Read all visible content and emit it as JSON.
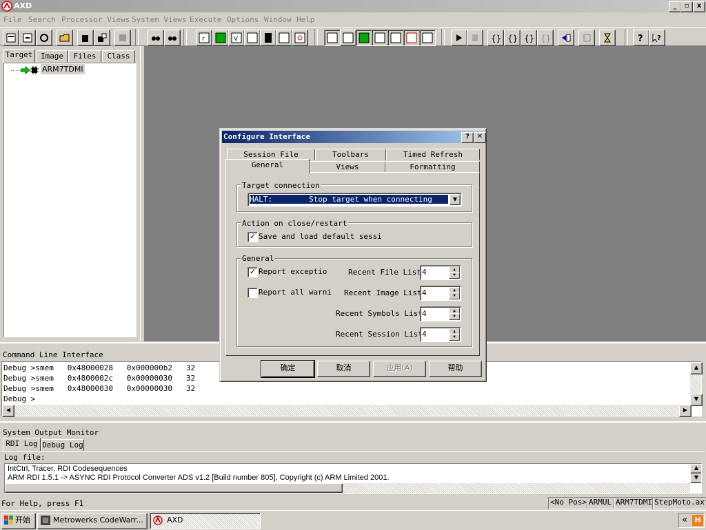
{
  "window": {
    "title": "AXD"
  },
  "menu": [
    "File",
    "Search",
    "Processor Views",
    "System Views",
    "Execute",
    "Options",
    "Window",
    "Help"
  ],
  "left_pane": {
    "tabs": [
      "Target",
      "Image",
      "Files",
      "Class"
    ],
    "tree_item": "ARM7TDMI"
  },
  "dialog": {
    "title": "Configure Interface",
    "help_btn": "?",
    "close_btn": "✕",
    "tabs_back": [
      "Session File",
      "Toolbars",
      "Timed Refresh"
    ],
    "tabs_front": [
      "General",
      "Views",
      "Formatting"
    ],
    "target_group": "Target connection",
    "target_select": "HALT:        Stop target when connecting",
    "close_group": "Action on close/restart",
    "save_session_label": "Save and load default sessi",
    "general_group": "General",
    "report_exceptions_label": "Report exceptio",
    "report_warnings_label": "Report all warni",
    "recent_file_label": "Recent File List",
    "recent_file_value": "4",
    "recent_image_label": "Recent Image List",
    "recent_image_value": "4",
    "recent_symbols_label": "Recent Symbols List",
    "recent_symbols_value": "4",
    "recent_session_label": "Recent Session List",
    "recent_session_value": "4",
    "ok": "确定",
    "cancel": "取消",
    "apply": "应用(A)",
    "help": "帮助"
  },
  "cli": {
    "title": "Command Line Interface",
    "lines": [
      "Debug >smem   0x48000028   0x000000b2   32",
      "Debug >smem   0x4800002c   0x00000030   32",
      "Debug >smem   0x48000030   0x00000030   32",
      "Debug >"
    ]
  },
  "output": {
    "title": "System Output Monitor",
    "tabs": [
      "RDI Log",
      "Debug Log"
    ],
    "log_label": "Log file:",
    "lines": [
      "IntCtrl, Tracer, RDI Codesequences",
      "ARM RDI 1.5.1 -> ASYNC RDI Protocol Converter ADS v1.2 [Build number 805], Copyright (c) ARM Limited 2001."
    ]
  },
  "status": {
    "help": "For Help, press F1",
    "pos": "<No Pos>",
    "target": "ARMUL",
    "proc": "ARM7TDMI",
    "file": "StepMoto.axf"
  },
  "taskbar": {
    "start": "开始",
    "task1": "Metrowerks CodeWarr...",
    "task2": "AXD",
    "tray": "«"
  }
}
